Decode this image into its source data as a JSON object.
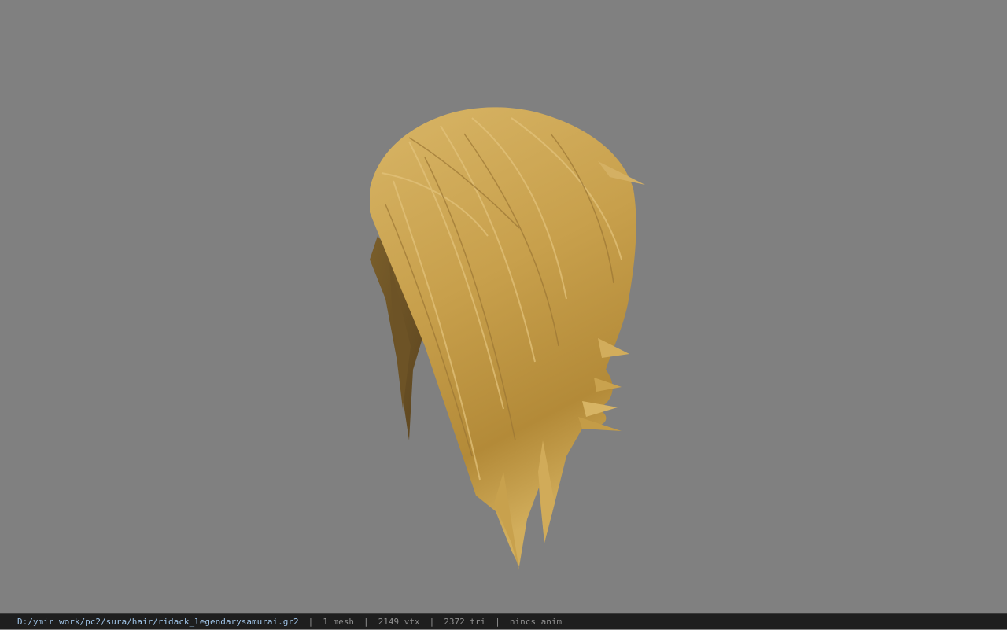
{
  "viewport": {
    "background_color": "#808080",
    "model_name": "ridack_legendarysamurai hair mesh",
    "hair_color": "#c9a24e"
  },
  "status_bar": {
    "file_path": "D:/ymir work/pc2/sura/hair/ridack_legendarysamurai.gr2",
    "separator": "|",
    "mesh_count": "1 mesh",
    "vertex_count": "2149 vtx",
    "triangle_count": "2372 tri",
    "animation": "nincs anim"
  }
}
